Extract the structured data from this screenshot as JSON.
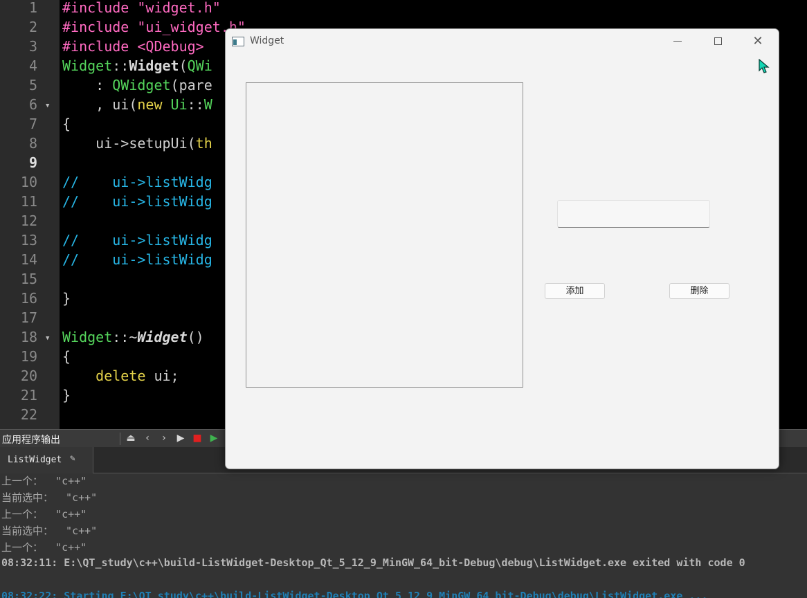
{
  "editor": {
    "lines": [
      {
        "num": "1",
        "html_parts": [
          [
            "c-pre",
            "#include "
          ],
          [
            "c-str",
            "\"widget.h\""
          ]
        ]
      },
      {
        "num": "2",
        "html_parts": [
          [
            "c-pre",
            "#include "
          ],
          [
            "c-str",
            "\"ui_widget.h\""
          ]
        ]
      },
      {
        "num": "3",
        "html_parts": [
          [
            "c-pre",
            "#include "
          ],
          [
            "c-str",
            "<QDebug>"
          ]
        ]
      },
      {
        "num": "4",
        "html_parts": [
          [
            "c-type",
            "Widget"
          ],
          [
            "c-def",
            "::"
          ],
          [
            "c-bold",
            "Widget"
          ],
          [
            "c-def",
            "("
          ],
          [
            "c-type",
            "QWi"
          ]
        ]
      },
      {
        "num": "5",
        "html_parts": [
          [
            "c-def",
            "    : "
          ],
          [
            "c-type",
            "QWidget"
          ],
          [
            "c-def",
            "(pare"
          ]
        ]
      },
      {
        "num": "6",
        "html_parts": [
          [
            "c-def",
            "    , ui("
          ],
          [
            "c-kw",
            "new "
          ],
          [
            "c-type",
            "Ui"
          ],
          [
            "c-def",
            "::"
          ],
          [
            "c-type",
            "W"
          ]
        ]
      },
      {
        "num": "7",
        "html_parts": [
          [
            "c-def",
            "{"
          ]
        ]
      },
      {
        "num": "8",
        "html_parts": [
          [
            "c-def",
            "    ui->setupUi("
          ],
          [
            "c-kw",
            "th"
          ]
        ]
      },
      {
        "num": "9",
        "html_parts": []
      },
      {
        "num": "10",
        "html_parts": [
          [
            "c-cmt",
            "//    ui->listWidg"
          ]
        ]
      },
      {
        "num": "11",
        "html_parts": [
          [
            "c-cmt",
            "//    ui->listWidg"
          ]
        ]
      },
      {
        "num": "12",
        "html_parts": []
      },
      {
        "num": "13",
        "html_parts": [
          [
            "c-cmt",
            "//    ui->listWidg"
          ]
        ]
      },
      {
        "num": "14",
        "html_parts": [
          [
            "c-cmt",
            "//    ui->listWidg"
          ]
        ]
      },
      {
        "num": "15",
        "html_parts": []
      },
      {
        "num": "16",
        "html_parts": [
          [
            "c-def",
            "}"
          ]
        ]
      },
      {
        "num": "17",
        "html_parts": []
      },
      {
        "num": "18",
        "html_parts": [
          [
            "c-type",
            "Widget"
          ],
          [
            "c-def",
            "::~"
          ],
          [
            "c-ital",
            "Widget"
          ],
          [
            "c-def",
            "()"
          ]
        ]
      },
      {
        "num": "19",
        "html_parts": [
          [
            "c-def",
            "{"
          ]
        ]
      },
      {
        "num": "20",
        "html_parts": [
          [
            "c-def",
            "    "
          ],
          [
            "c-kw",
            "delete"
          ],
          [
            "c-def",
            " ui;"
          ]
        ]
      },
      {
        "num": "21",
        "html_parts": [
          [
            "c-def",
            "}"
          ]
        ]
      },
      {
        "num": "22",
        "html_parts": []
      }
    ],
    "current_line": "9",
    "fold_lines": [
      "6",
      "18"
    ]
  },
  "output_pane": {
    "title": "应用程序输出",
    "tab_label": "ListWidget",
    "lines": [
      {
        "text": "上一个：  \"c++\"",
        "kind": "normal"
      },
      {
        "text": "当前选中：  \"c++\"",
        "kind": "normal"
      },
      {
        "text": "上一个：  \"c++\"",
        "kind": "normal"
      },
      {
        "text": "当前选中：  \"c++\"",
        "kind": "normal"
      },
      {
        "text": "上一个：  \"c++\"",
        "kind": "normal"
      },
      {
        "text": "08:32:11: E:\\QT_study\\c++\\build-ListWidget-Desktop_Qt_5_12_9_MinGW_64_bit-Debug\\debug\\ListWidget.exe exited with code 0",
        "kind": "status"
      },
      {
        "text": "",
        "kind": "normal"
      },
      {
        "text": "08:32:22: Starting E:\\QT_study\\c++\\build-ListWidget-Desktop_Qt_5_12_9_MinGW_64_bit-Debug\\debug\\ListWidget.exe ...",
        "kind": "start"
      }
    ]
  },
  "widget_window": {
    "title": "Widget",
    "input_value": "",
    "add_button": "添加",
    "delete_button": "删除"
  }
}
